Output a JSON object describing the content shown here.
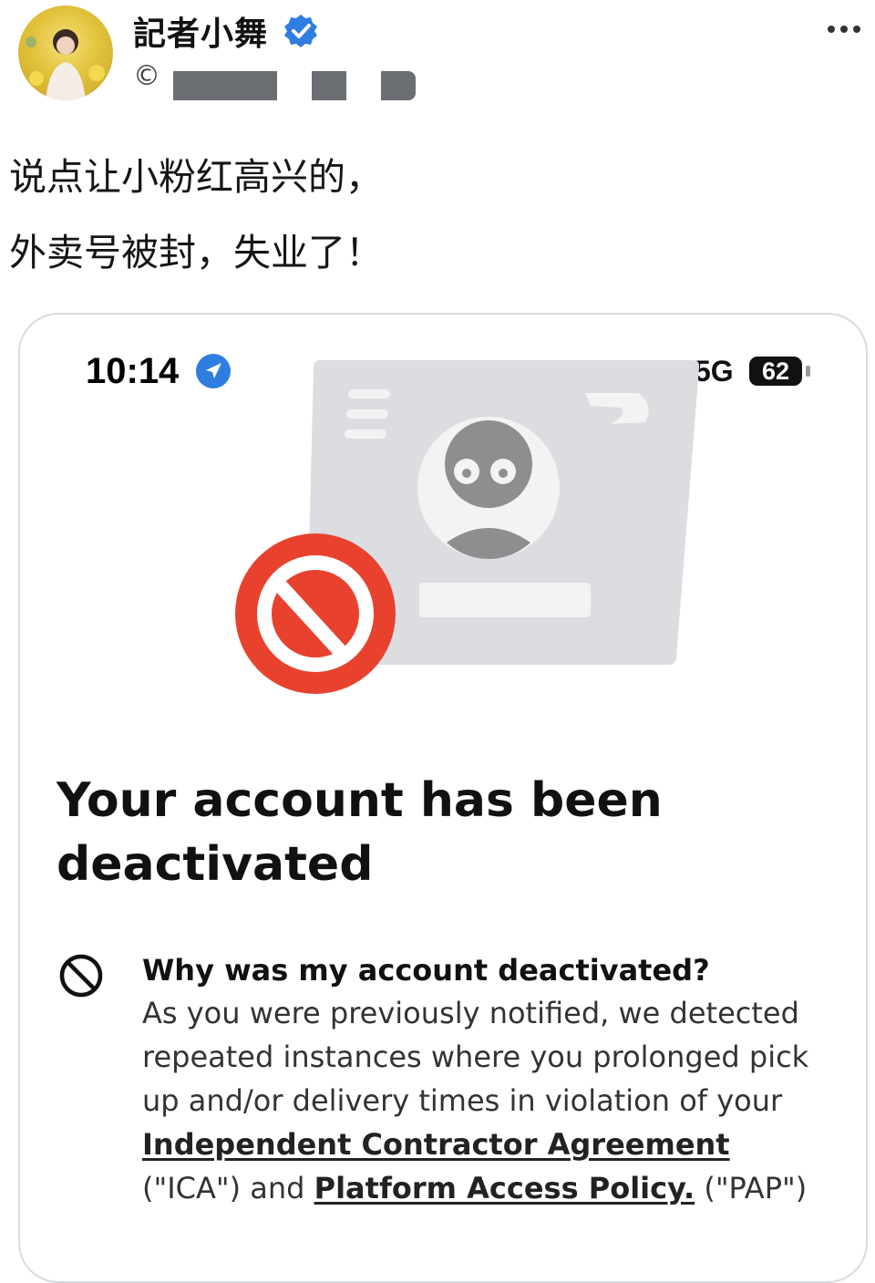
{
  "post": {
    "author_name": "記者小舞",
    "handle_prefix": "©",
    "lines": [
      "说点让小粉红高兴的，",
      "外卖号被封，失业了！"
    ]
  },
  "icons": {
    "verified": "verified-badge-icon",
    "more": "more-options-icon",
    "location": "location-arrow-icon",
    "signal": "cellular-signal-icon",
    "reason": "prohibited-icon"
  },
  "screenshot": {
    "status_bar": {
      "time": "10:14",
      "network": "5G",
      "battery": "62"
    },
    "headline": "Your account has been deactivated",
    "reason": {
      "title": "Why was my account deactivated?",
      "body_intro": "As you were previously notified, we detected repeated instances where you prolonged pick up and/or delivery times in violation of your ",
      "link_ica": "Independent Contractor Agreement",
      "body_mid": " (\"ICA\") and ",
      "link_pap": "Platform Access Policy.",
      "body_end": " (\"PAP\")"
    }
  },
  "colors": {
    "verified_blue": "#2f7de1",
    "location_blue": "#2f7de1",
    "prohibited_red": "#e8422f",
    "card_gray": "#dcdde0",
    "avatar_gray": "#8e8e91"
  }
}
